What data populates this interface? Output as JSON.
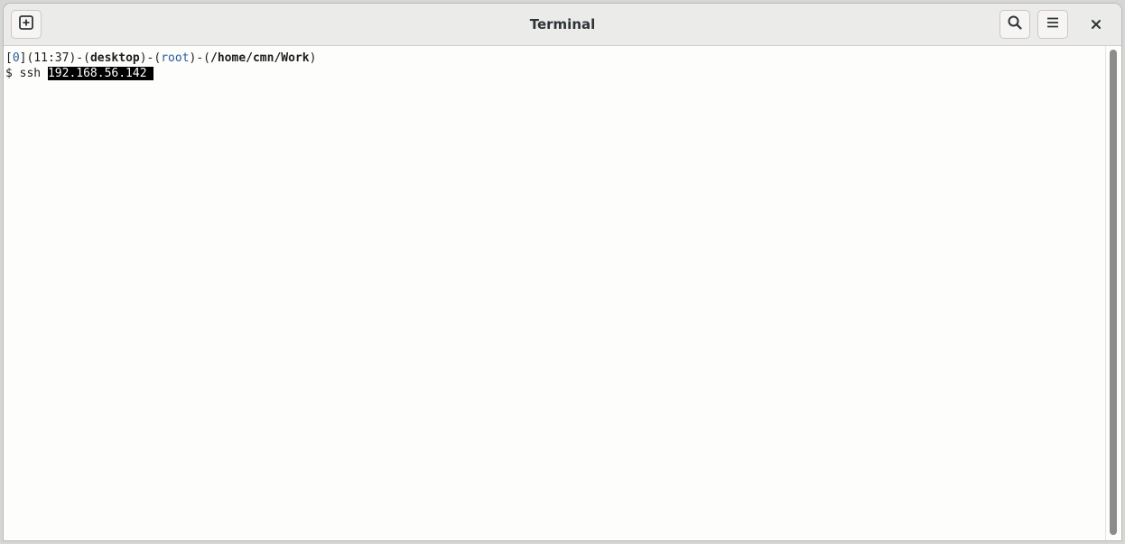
{
  "window": {
    "title": "Terminal"
  },
  "header": {
    "new_tab_icon": "plus-square-icon",
    "search_icon": "search-icon",
    "menu_icon": "hamburger-menu-icon",
    "close_icon": "close-icon"
  },
  "terminal": {
    "prompt": {
      "status_open": "[",
      "status_code": "0",
      "status_close": "]",
      "time": "(11:37)",
      "sep1": "-(",
      "host": "desktop",
      "sep2": ")-(",
      "user": "root",
      "sep3": ")-(",
      "path": "/home/cmn/Work",
      "end": ")"
    },
    "command": {
      "symbol": "$ ssh ",
      "selected_arg": "192.168.56.142 "
    }
  },
  "colors": {
    "selection_bg": "#000000",
    "accent_blue": "#2a5a9c",
    "titlebar_bg": "#ebebea"
  }
}
